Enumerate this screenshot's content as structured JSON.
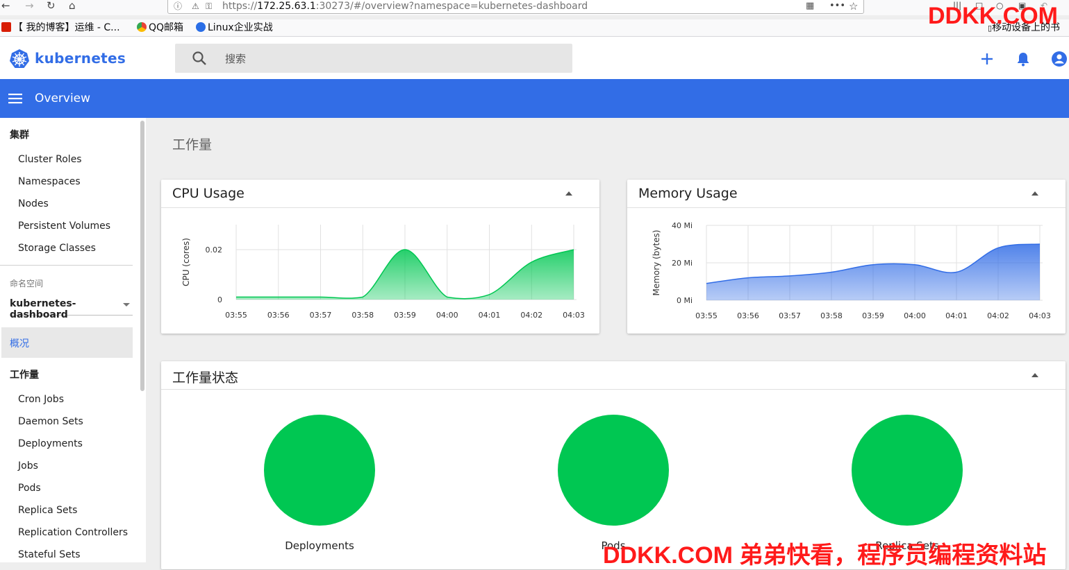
{
  "browser": {
    "url_prefix": "https://",
    "url_host": "172.25.63.1",
    "url_rest": ":30273/#/overview?namespace=kubernetes-dashboard",
    "bookmarks": [
      {
        "label": "【 我的博客】运维 - C..."
      },
      {
        "label": "QQ邮箱"
      },
      {
        "label": "Linux企业实战"
      }
    ],
    "mobile_bookmarks": "移动设备上的书",
    "watermark_top": "DDKK.COM",
    "watermark_bottom": "DDKK.COM 弟弟快看，程序员编程资料站"
  },
  "header": {
    "brand": "kubernetes",
    "search_placeholder": "搜索"
  },
  "toolbar": {
    "title": "Overview"
  },
  "sidebar": {
    "cluster_header": "集群",
    "cluster_items": [
      "Cluster Roles",
      "Namespaces",
      "Nodes",
      "Persistent Volumes",
      "Storage Classes"
    ],
    "namespace_label": "命名空间",
    "namespace_value": "kubernetes-dashboard",
    "overview_label": "概况",
    "workloads_header": "工作量",
    "workload_items": [
      "Cron Jobs",
      "Daemon Sets",
      "Deployments",
      "Jobs",
      "Pods",
      "Replica Sets",
      "Replication Controllers",
      "Stateful Sets"
    ]
  },
  "main": {
    "section_title": "工作量",
    "workload_status_title": "工作量状态",
    "status_items": [
      {
        "label": "Deployments"
      },
      {
        "label": "Pods"
      },
      {
        "label": "Replica Sets"
      }
    ]
  },
  "colors": {
    "accent": "#326de6",
    "cpu_fill": "#00c752",
    "memory_fill": "#326de6",
    "status_ok": "#00c752"
  },
  "chart_data": [
    {
      "type": "area",
      "title": "CPU Usage",
      "ylabel": "CPU (cores)",
      "x": [
        "03:55",
        "03:56",
        "03:57",
        "03:58",
        "03:59",
        "04:00",
        "04:01",
        "04:02",
        "04:03"
      ],
      "values": [
        0.001,
        0.001,
        0.001,
        0.001,
        0.02,
        0.001,
        0.002,
        0.015,
        0.02
      ],
      "y_ticks": [
        "0",
        "0.02"
      ],
      "y_tick_values": [
        0,
        0.02
      ],
      "ylim": [
        0,
        0.03
      ],
      "grid": true
    },
    {
      "type": "area",
      "title": "Memory Usage",
      "ylabel": "Memory (bytes)",
      "x": [
        "03:55",
        "03:56",
        "03:57",
        "03:58",
        "03:59",
        "04:00",
        "04:01",
        "04:02",
        "04:03"
      ],
      "values": [
        9,
        12,
        13,
        15,
        19,
        19,
        15,
        28,
        30
      ],
      "y_ticks": [
        "0 Mi",
        "20 Mi",
        "40 Mi"
      ],
      "y_tick_values": [
        0,
        20,
        40
      ],
      "ylim": [
        0,
        40
      ],
      "grid": true
    }
  ]
}
